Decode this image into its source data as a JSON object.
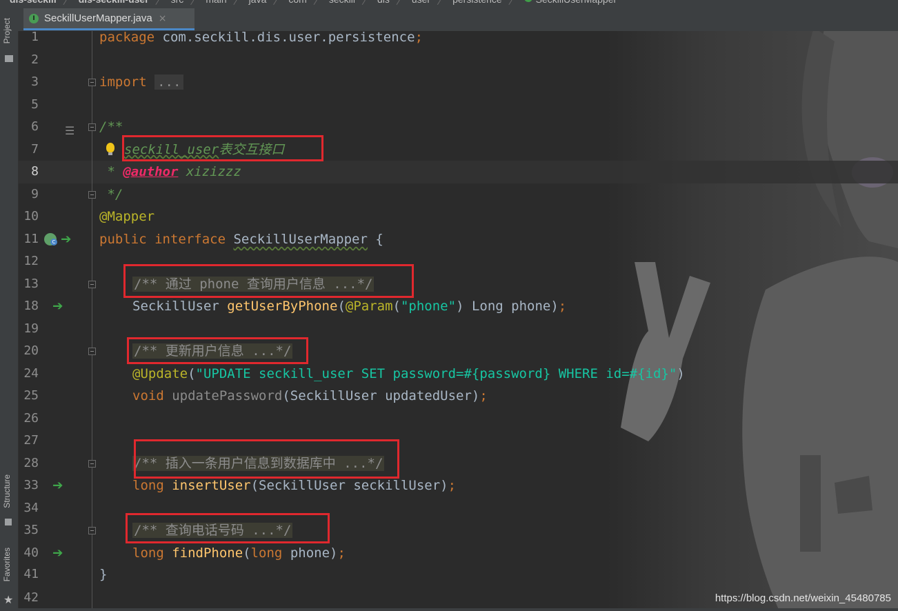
{
  "breadcrumb": [
    "dis-seckill",
    "dis-seckill-user",
    "src",
    "main",
    "java",
    "com",
    "seckill",
    "dis",
    "user",
    "persistence",
    "SeckillUserMapper"
  ],
  "tool_strip": {
    "project": "Project",
    "structure": "Structure",
    "favorites": "Favorites"
  },
  "tab": {
    "filename": "SeckillUserMapper.java",
    "close": "×",
    "icon_letter": "I"
  },
  "lines": {
    "n1": "1",
    "n2": "2",
    "n3": "3",
    "n5": "5",
    "n6": "6",
    "n7": "7",
    "n8": "8",
    "n9": "9",
    "n10": "10",
    "n11": "11",
    "n12": "12",
    "n13": "13",
    "n18": "18",
    "n19": "19",
    "n20": "20",
    "n24": "24",
    "n25": "25",
    "n26": "26",
    "n27": "27",
    "n28": "28",
    "n33": "33",
    "n34": "34",
    "n35": "35",
    "n40": "40",
    "n41": "41",
    "n42": "42"
  },
  "code": {
    "l1_kw": "package",
    "l1_rest": " com.seckill.dis.user.persistence",
    "l1_semi": ";",
    "l3_kw": "import",
    "l3_fold": "...",
    "l6": "/**",
    "l7_a": "seckill_user",
    "l7_b": "表交互接口",
    "l8_star": " * ",
    "l8_tag": "@author",
    "l8_name": " xizizzz",
    "l9": " */",
    "l10": "@Mapper",
    "l11_kw": "public interface ",
    "l11_name": "SeckillUserMapper",
    "l11_rest": " {",
    "l13": "/** 通过 phone 查询用户信息 ...*/",
    "l18_type": "SeckillUser ",
    "l18_meth": "getUserByPhone",
    "l18_p1": "(",
    "l18_ann": "@Param",
    "l18_p2": "(",
    "l18_str": "\"phone\"",
    "l18_p3": ") Long phone)",
    "l18_semi": ";",
    "l20": "/** 更新用户信息 ...*/",
    "l24_ann": "@Update",
    "l24_p": "(",
    "l24_str": "\"UPDATE seckill_user SET password=#{password} WHERE id=#{id}\"",
    "l24_end": ")",
    "l25_kw": "void",
    "l25_meth": " updatePassword",
    "l25_rest": "(SeckillUser updatedUser)",
    "l25_semi": ";",
    "l28": "/** 插入一条用户信息到数据库中 ...*/",
    "l33_kw": "long",
    "l33_meth": " insertUser",
    "l33_rest": "(SeckillUser seckillUser)",
    "l33_semi": ";",
    "l35": "/** 查询电话号码 ...*/",
    "l40_kw": "long",
    "l40_meth": " findPhone",
    "l40_p": "(",
    "l40_kw2": "long",
    "l40_rest": " phone)",
    "l40_semi": ";",
    "l41": "}"
  },
  "watermark": "https://blog.csdn.net/weixin_45480785",
  "colors": {
    "keyword": "#cc7832",
    "annotation": "#bbb529",
    "doc_comment": "#629755",
    "string": "#17c6a3",
    "method": "#ffc66d",
    "highlight_box": "#e0282e",
    "background": "#2b2b2b"
  }
}
